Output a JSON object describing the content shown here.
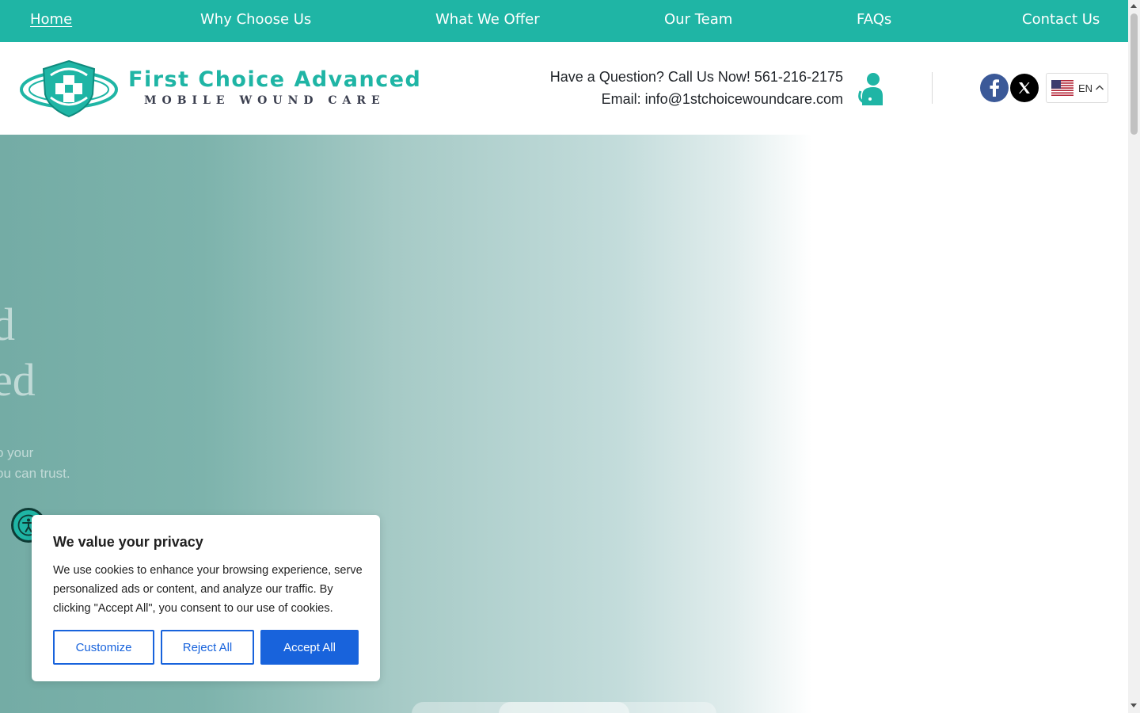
{
  "nav": {
    "items": [
      {
        "label": "Home",
        "active": true
      },
      {
        "label": "Why Choose Us"
      },
      {
        "label": "What We Offer"
      },
      {
        "label": "Our Team"
      },
      {
        "label": "FAQs"
      },
      {
        "label": "Contact Us"
      }
    ]
  },
  "header": {
    "logo_title": "First Choice Advanced",
    "logo_subtitle": "MOBILE WOUND CARE",
    "phone_line": "Have a Question? Call Us Now! 561-216-2175",
    "email_line": "Email: info@1stchoicewoundcare.com",
    "social": [
      "facebook-icon",
      "x-icon"
    ],
    "language": "EN"
  },
  "hero": {
    "heading_line1": "d",
    "heading_line2": "ed",
    "text_line1": "o your",
    "text_line2": "ou can trust."
  },
  "cookie": {
    "title": "We value your privacy",
    "body": "We use cookies to enhance your browsing experience, serve personalized ads or content, and analyze our traffic. By clicking \"Accept All\", you consent to our use of cookies.",
    "customize": "Customize",
    "reject": "Reject All",
    "accept": "Accept All"
  },
  "colors": {
    "brand_teal": "#1fb5a5",
    "accept_blue": "#1863dc"
  }
}
